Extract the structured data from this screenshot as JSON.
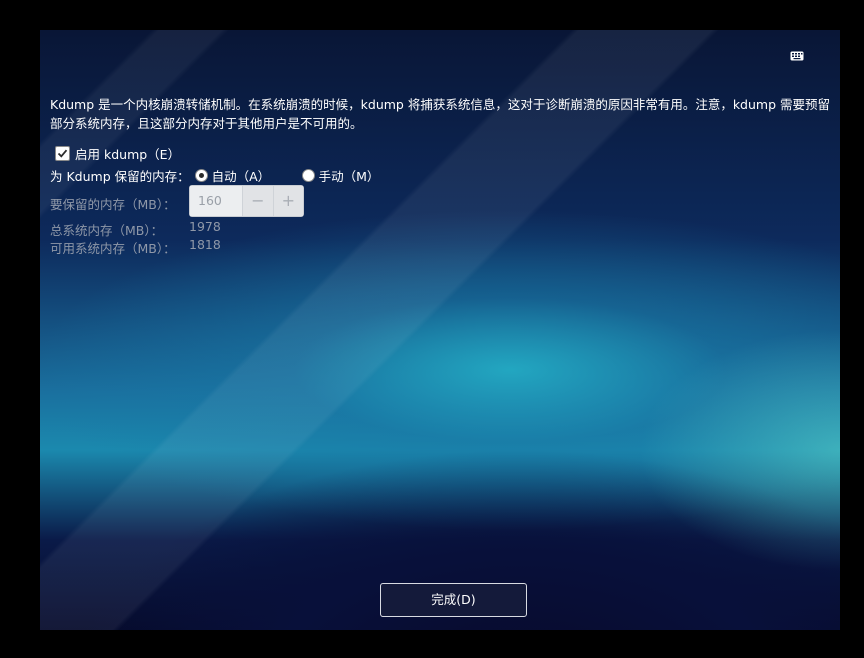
{
  "keyboard_icon": "keyboard-icon",
  "description_line1": "Kdump 是一个内核崩溃转储机制。在系统崩溃的时候，kdump 将捕获系统信息，这对于诊断崩溃的原因非常有用。注意，kdump 需要预留",
  "description_line2": "部分系统内存，且这部分内存对于其他用户是不可用的。",
  "enable_kdump": {
    "label": "启用 kdump（E）",
    "checked": true
  },
  "reserve_memory": {
    "label": "为 Kdump 保留的内存：",
    "auto_label": "自动（A）",
    "manual_label": "手动（M）",
    "selected": "auto"
  },
  "memory_to_reserve": {
    "label": "要保留的内存（MB）：",
    "value": "160",
    "minus": "−",
    "plus": "+"
  },
  "total_memory": {
    "label": "总系统内存（MB）：",
    "value": "1978"
  },
  "usable_memory": {
    "label": "可用系统内存（MB）：",
    "value": "1818"
  },
  "done_button": "完成(D)"
}
